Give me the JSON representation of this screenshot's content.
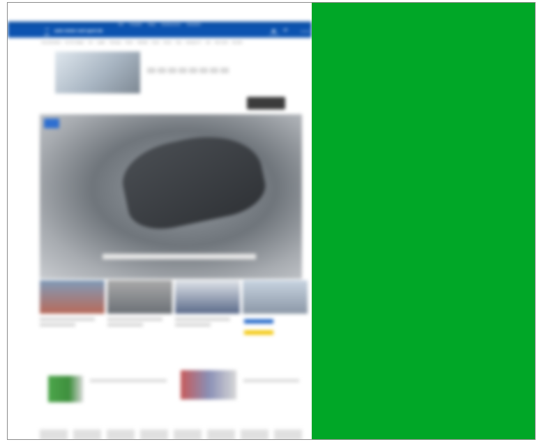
{
  "topnav": {
    "items": [
      "Wet",
      "Produkte",
      "Shop",
      "Sonderservice",
      "Newsletter"
    ]
  },
  "header": {
    "logo": "auto motor und sport.de",
    "menu_label": "Menü",
    "account_label": "Anmelden",
    "cart_count": "67",
    "extra_label": "Newsletter"
  },
  "subnav": {
    "items": [
      "Zoom (Anmelden)",
      "Top Thé Collagne",
      "Test",
      "Logistik",
      "Fahrzeuge",
      "Partner",
      "Werkstatt",
      "Events",
      "Service",
      "Shop",
      "motorsport-TV",
      "Jobs",
      "Wie es Wird",
      "Abo-Welt"
    ]
  },
  "colors": {
    "header_blue": "#0c53b0",
    "green_panel": "#00a727"
  }
}
